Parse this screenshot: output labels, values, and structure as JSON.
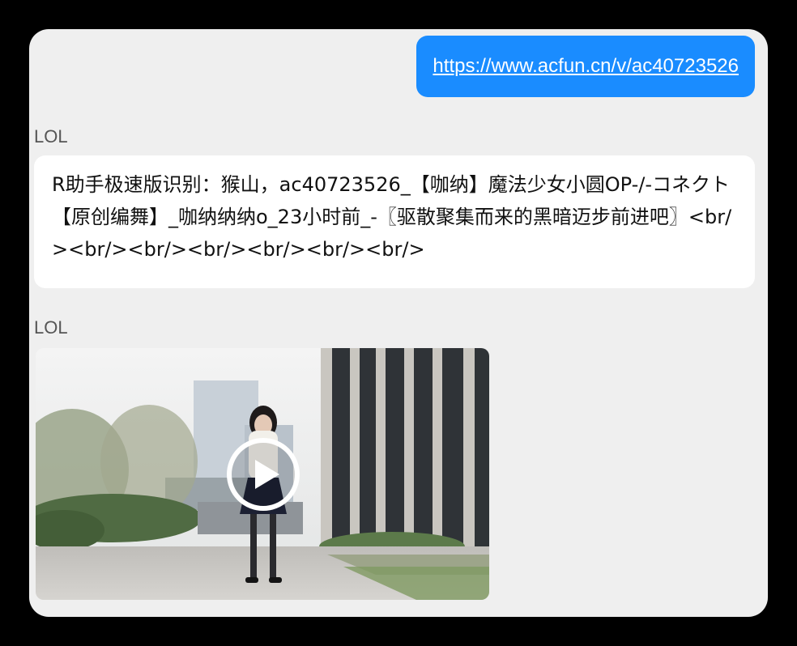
{
  "messages": {
    "outgoing": {
      "link_text": "https://www.acfun.cn/v/ac40723526"
    },
    "incoming_text": {
      "sender": "LOL",
      "text": "R助手极速版识别：猴山，ac40723526_【咖纳】魔法少女小圆OP-/-コネクト【原创编舞】_咖纳纳纳o_23小时前_-〖驱散聚集而来的黑暗迈步前进吧〗<br/><br/><br/><br/><br/><br/><br/>"
    },
    "incoming_video": {
      "sender": "LOL",
      "play_icon": "play-icon"
    }
  },
  "colors": {
    "outgoing_bubble": "#1a8cff",
    "panel_background": "#efefef",
    "incoming_bubble": "#ffffff"
  }
}
